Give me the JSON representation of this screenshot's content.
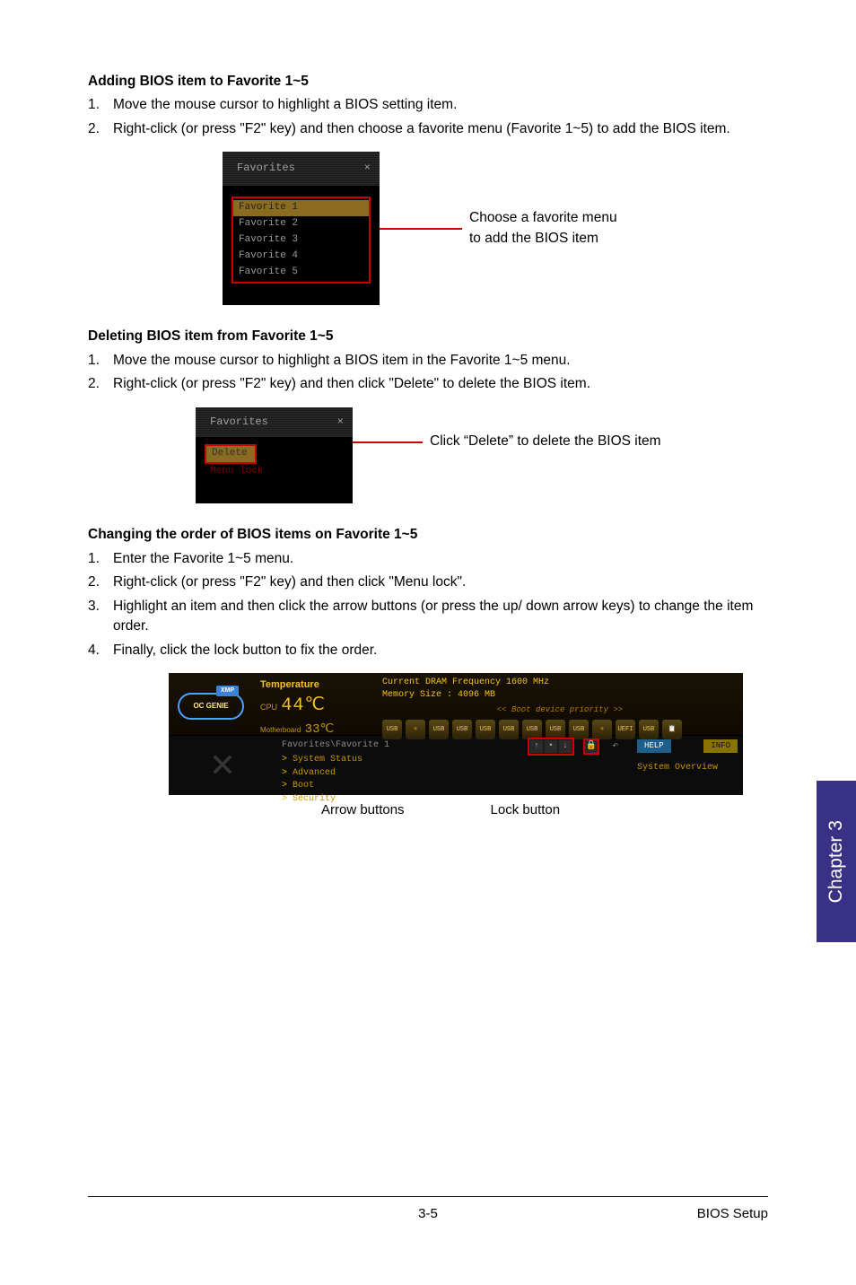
{
  "sections": {
    "add": {
      "title": "Adding BIOS item to Favorite 1~5",
      "steps": [
        "Move the mouse cursor to highlight a BIOS setting item.",
        "Right-click (or press \"F2\" key) and then choose a favorite menu (Favorite 1~5) to add the BIOS item."
      ],
      "panel_header": "Favorites",
      "panel_close": "×",
      "items": [
        "Favorite 1",
        "Favorite 2",
        "Favorite 3",
        "Favorite 4",
        "Favorite 5"
      ],
      "callout_line1": "Choose a favorite menu",
      "callout_line2": "to add the BIOS item"
    },
    "delete": {
      "title": "Deleting BIOS item from Favorite 1~5",
      "steps": [
        "Move the mouse cursor to highlight a BIOS item in the Favorite 1~5 menu.",
        "Right-click (or press \"F2\" key) and then click \"Delete\" to delete the BIOS item."
      ],
      "panel_header": "Favorites",
      "panel_close": "×",
      "item_delete": "Delete",
      "item_menulock": "Menu lock",
      "callout": "Click “Delete” to delete the BIOS item"
    },
    "change": {
      "title": "Changing the order of BIOS items on Favorite 1~5",
      "steps": [
        "Enter the Favorite 1~5 menu.",
        "Right-click (or press \"F2\" key) and then click \"Menu lock\".",
        "Highlight an item and then click the arrow buttons (or press the up/ down arrow keys) to change the item order.",
        "Finally, click the lock button to fix the order."
      ]
    }
  },
  "bios": {
    "oc_genie": "OC\nGENIE",
    "xmp": "XMP",
    "temperature_label": "Temperature",
    "cpu_label": "CPU",
    "mb_label": "Motherboard",
    "cpu_temp": "44℃",
    "mb_temp": "33℃",
    "dram_line": "Current DRAM Frequency 1600 MHz",
    "mem_line": "Memory Size : 4096 MB",
    "boot_priority": "<<  Boot device priority  >>",
    "breadcrumb": "Favorites\\Favorite 1",
    "menu": [
      "System Status",
      "Advanced",
      "Boot",
      "Security"
    ],
    "help": "HELP",
    "info": "INFO",
    "sys_overview": "System Overview",
    "arrow_label": "Arrow buttons",
    "lock_label": "Lock button"
  },
  "chapter_tab": "Chapter 3",
  "footer": {
    "page": "3-5",
    "section": "BIOS Setup"
  }
}
